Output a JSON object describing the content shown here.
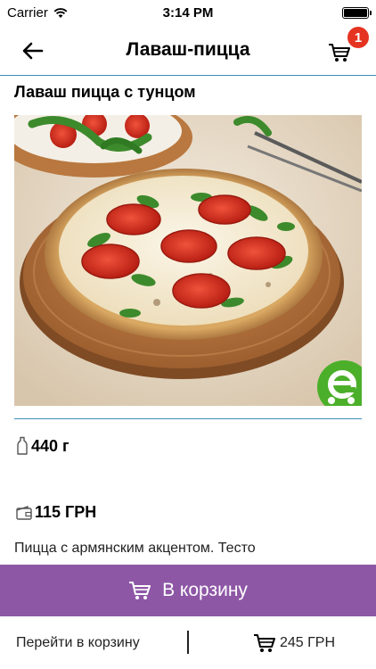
{
  "status_bar": {
    "carrier": "Carrier",
    "time": "3:14 PM"
  },
  "nav": {
    "title": "Лаваш-пицца",
    "cart_count": "1"
  },
  "product": {
    "name": "Лаваш пицца с тунцом",
    "weight": "440 г",
    "price": "115 ГРН",
    "description": "Пицца с армянским акцентом. Тесто"
  },
  "actions": {
    "add_to_cart": "В корзину"
  },
  "footer": {
    "go_to_cart": "Перейти в корзину",
    "total": "245 ГРН"
  },
  "colors": {
    "accent_line": "#3a8fb7",
    "button": "#8e57a6",
    "badge": "#e53322"
  }
}
